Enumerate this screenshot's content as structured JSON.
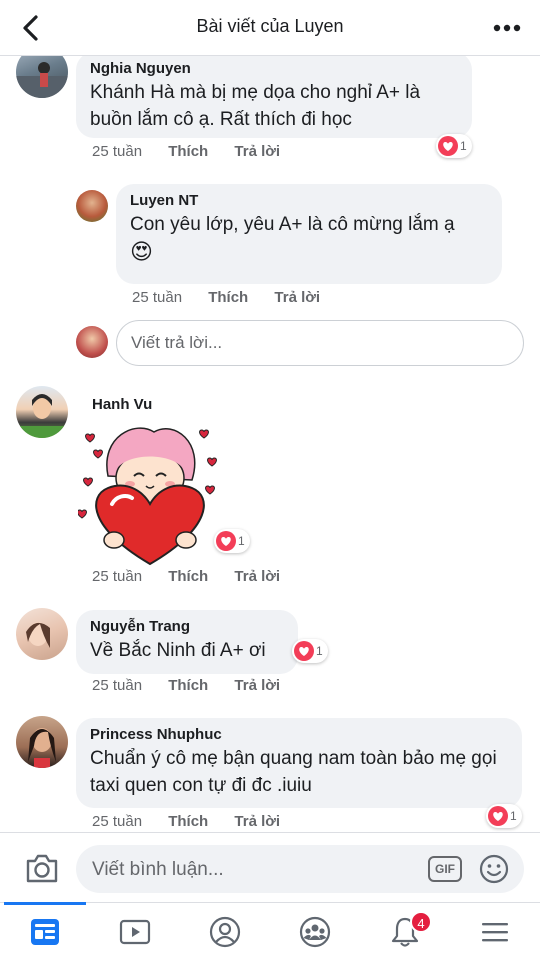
{
  "header": {
    "title": "Bài viết của Luyen"
  },
  "comments": [
    {
      "author": "Nghia Nguyen",
      "text": "Khánh Hà mà bị mẹ dọa cho nghỉ A+ là buồn lắm cô ạ. Rất thích đi học",
      "time": "25 tuần",
      "like": "Thích",
      "reply": "Trả lời",
      "reactions": "1"
    },
    {
      "author": "Luyen NT",
      "text": "Con yêu lớp, yêu A+ là cô mừng lắm ạ",
      "emoji": "😍",
      "time": "25 tuần",
      "like": "Thích",
      "reply": "Trả lời"
    },
    {
      "author": "Hanh Vu",
      "sticker": "heart-girl-sticker",
      "time": "25 tuần",
      "like": "Thích",
      "reply": "Trả lời",
      "reactions": "1"
    },
    {
      "author": "Nguyễn Trang",
      "text": "Về Bắc Ninh đi A+ ơi",
      "time": "25 tuần",
      "like": "Thích",
      "reply": "Trả lời",
      "reactions": "1"
    },
    {
      "author": "Princess Nhuphuc",
      "text": "Chuẩn ý cô mẹ bận quang nam toàn bảo mẹ gọi taxi quen con tự đi đc .iuiu",
      "time": "25 tuần",
      "like": "Thích",
      "reply": "Trả lời",
      "reactions": "1"
    }
  ],
  "reply_box": {
    "placeholder": "Viết trả lời..."
  },
  "composer": {
    "placeholder": "Viết bình luận...",
    "gif_label": "GIF"
  },
  "tabbar": {
    "tabs": [
      "news-feed-icon",
      "watch-icon",
      "profile-icon",
      "groups-icon",
      "notifications-icon",
      "menu-icon"
    ],
    "notification_count": "4"
  },
  "colors": {
    "accent": "#1877f2",
    "bubble": "#f0f2f5",
    "meta": "#65676b",
    "badge": "#e41e3f",
    "heart": "#f33e58"
  }
}
